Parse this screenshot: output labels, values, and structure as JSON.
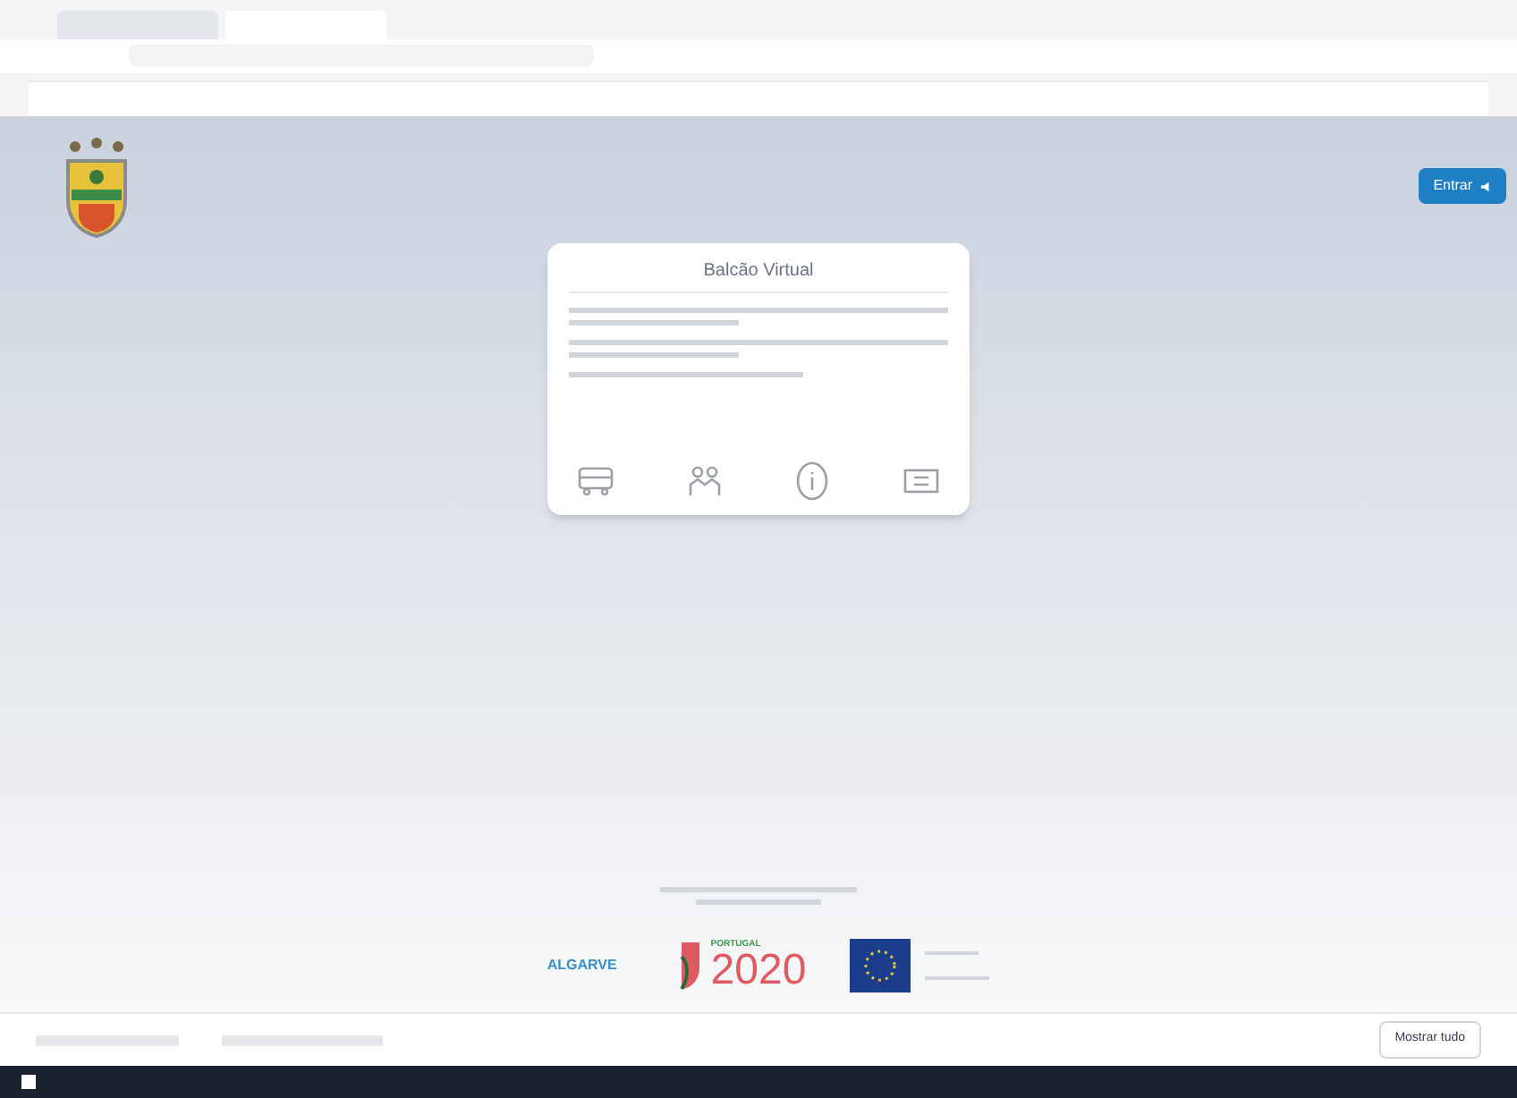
{
  "card": {
    "title": "Balcão Virtual"
  },
  "login_button": {
    "label": "Entrar"
  },
  "logos": [
    {
      "kind": "algarve",
      "label": "ALGARVE"
    },
    {
      "kind": "portugal2020",
      "caption": "PORTUGAL",
      "label": "2020"
    },
    {
      "kind": "eu"
    }
  ],
  "downloads_bar": {
    "show_all": "Mostrar tudo"
  }
}
